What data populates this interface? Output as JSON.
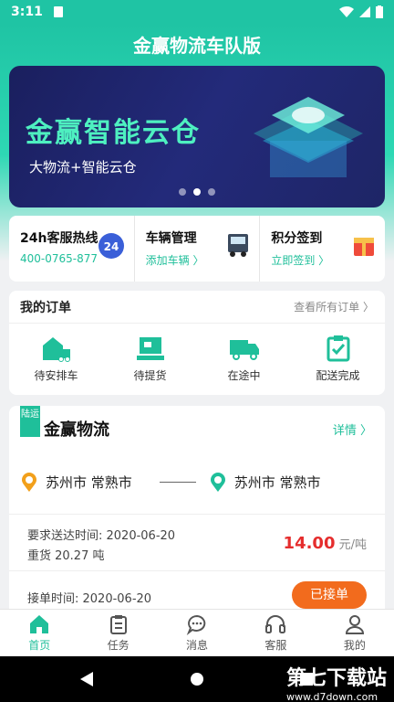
{
  "status": {
    "time": "3:11"
  },
  "app": {
    "title": "金赢物流车队版",
    "accent": "#1fbf9a"
  },
  "banner": {
    "title": "金赢智能云仓",
    "subtitle": "大物流+智能云仓",
    "slides": 3,
    "active_slide": 2
  },
  "services": [
    {
      "name": "24h客服热线",
      "sub": "400-0765-877",
      "icon": "24h-service-icon"
    },
    {
      "name": "车辆管理",
      "sub": "添加车辆 〉",
      "icon": "truck-icon"
    },
    {
      "name": "积分签到",
      "sub": "立即签到 〉",
      "icon": "gift-icon"
    }
  ],
  "orders": {
    "title": "我的订单",
    "view_all": "查看所有订单 〉",
    "items": [
      {
        "label": "待安排车",
        "icon": "warehouse-truck-icon"
      },
      {
        "label": "待提货",
        "icon": "pickup-box-icon"
      },
      {
        "label": "在途中",
        "icon": "in-transit-truck-icon"
      },
      {
        "label": "配送完成",
        "icon": "delivered-clipboard-icon"
      }
    ]
  },
  "order_card": {
    "tag": "陆运",
    "carrier": "金赢物流",
    "detail_link": "详情 〉",
    "from": "苏州市 常熟市",
    "to": "苏州市 常熟市",
    "deadline": "要求送达时间: 2020-06-20",
    "cargo": "重货  20.27 吨",
    "price": "14.00",
    "price_unit": " 元/吨",
    "accept_time": "接单时间: 2020-06-20",
    "status_button": "已接单"
  },
  "tabs": [
    {
      "label": "首页",
      "icon": "home-icon",
      "active": true
    },
    {
      "label": "任务",
      "icon": "clipboard-icon"
    },
    {
      "label": "消息",
      "icon": "message-icon"
    },
    {
      "label": "客服",
      "icon": "headset-icon"
    },
    {
      "label": "我的",
      "icon": "person-icon"
    }
  ],
  "watermark": {
    "title": "第七下载站",
    "url": "www.d7down.com"
  }
}
